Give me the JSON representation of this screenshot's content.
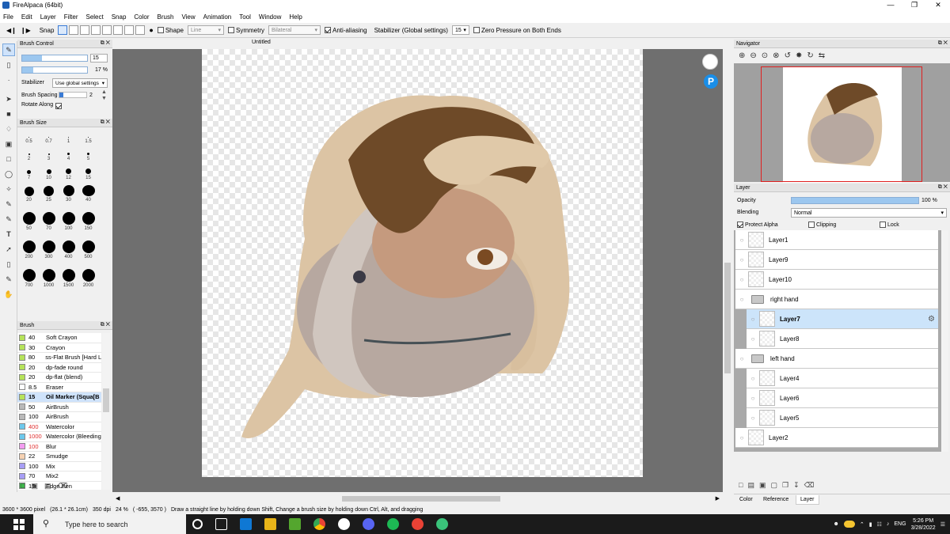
{
  "window": {
    "title": "FireAlpaca (64bit)"
  },
  "menu": [
    "File",
    "Edit",
    "Layer",
    "Filter",
    "Select",
    "Snap",
    "Color",
    "Brush",
    "View",
    "Animation",
    "Tool",
    "Window",
    "Help"
  ],
  "toolbar": {
    "snap_label": "Snap",
    "shape_label": "Shape",
    "shape_value": "Line",
    "symmetry_label": "Symmetry",
    "symmetry_value": "Bilateral",
    "antialias_label": "Anti-aliasing",
    "stabilizer_label": "Stabilizer (Global settings)",
    "stabilizer_value": "15",
    "zero_pressure_label": "Zero Pressure on Both Ends"
  },
  "brush_control": {
    "title": "Brush Control",
    "size_value": "15",
    "opacity_value": "17 %",
    "stabilizer_label": "Stabilizer",
    "stabilizer_value": "Use global settings",
    "spacing_label": "Brush Spacing",
    "spacing_value": "2",
    "rotate_label": "Rotate Along"
  },
  "brush_size": {
    "title": "Brush Size",
    "sizes": [
      "0.5",
      "0.7",
      "1",
      "1.5",
      "2",
      "3",
      "4",
      "5",
      "7",
      "10",
      "12",
      "15",
      "20",
      "25",
      "30",
      "40",
      "50",
      "70",
      "100",
      "150",
      "200",
      "300",
      "400",
      "500",
      "700",
      "1000",
      "1500",
      "2000"
    ]
  },
  "brush_list": {
    "title": "Brush",
    "items": [
      {
        "size": "40",
        "name": "Soft Crayon",
        "color": "#b6e35a"
      },
      {
        "size": "30",
        "name": "Crayon",
        "color": "#b6e35a"
      },
      {
        "size": "80",
        "name": "ss-Flat Brush [Hard Li",
        "color": "#b6e35a"
      },
      {
        "size": "20",
        "name": "dp-fade round",
        "color": "#b6e35a"
      },
      {
        "size": "20",
        "name": "dp-flat (blend)",
        "color": "#b6e35a"
      },
      {
        "size": "8.5",
        "name": "Eraser",
        "color": "#ffffff"
      },
      {
        "size": "15",
        "name": "Oil Marker (Squa[B",
        "color": "#b6e35a"
      },
      {
        "size": "50",
        "name": "AirBrush",
        "color": "#b9b9b9"
      },
      {
        "size": "100",
        "name": "AirBrush",
        "color": "#b9b9b9"
      },
      {
        "size": "400",
        "name": "Watercolor",
        "color": "#6dc8ec"
      },
      {
        "size": "1000",
        "name": "Watercolor (Bleeding",
        "color": "#6dc8ec"
      },
      {
        "size": "100",
        "name": "Blur",
        "color": "#f39cf0"
      },
      {
        "size": "22",
        "name": "Smudge",
        "color": "#f6d2b3"
      },
      {
        "size": "100",
        "name": "Mix",
        "color": "#a79ef5"
      },
      {
        "size": "70",
        "name": "Mix2",
        "color": "#a79ef5"
      },
      {
        "size": "15",
        "name": "Edge Pen",
        "color": "#3fb64b"
      }
    ]
  },
  "canvas": {
    "tab": "Untitled"
  },
  "navigator": {
    "title": "Navigator"
  },
  "layer_panel": {
    "title": "Layer",
    "opacity_label": "Opacity",
    "opacity_value": "100 %",
    "blending_label": "Blending",
    "blending_value": "Normal",
    "protect_alpha": "Protect Alpha",
    "clipping": "Clipping",
    "lock": "Lock",
    "layers": [
      {
        "name": "Layer1",
        "type": "layer"
      },
      {
        "name": "Layer9",
        "type": "layer"
      },
      {
        "name": "Layer10",
        "type": "layer"
      },
      {
        "name": "right hand",
        "type": "folder"
      },
      {
        "name": "Layer7",
        "type": "layer",
        "selected": true
      },
      {
        "name": "Layer8",
        "type": "layer"
      },
      {
        "name": "left hand",
        "type": "folder"
      },
      {
        "name": "Layer4",
        "type": "layer"
      },
      {
        "name": "Layer6",
        "type": "layer"
      },
      {
        "name": "Layer5",
        "type": "layer"
      },
      {
        "name": "Layer2",
        "type": "layer"
      }
    ]
  },
  "bottom_tabs": [
    "Color",
    "Reference",
    "Layer"
  ],
  "status": {
    "dimensions": "3600 * 3600 pixel",
    "cm": "(26.1 * 26.1cm)",
    "dpi": "350 dpi",
    "zoom": "24 %",
    "coords": "( -655, 3570 )",
    "hint": "Draw a straight line by holding down Shift, Change a brush size by holding down Ctrl, Alt, and dragging"
  },
  "taskbar": {
    "search_placeholder": "Type here to search",
    "lang": "ENG",
    "time": "5:26 PM",
    "date": "3/28/2022"
  }
}
